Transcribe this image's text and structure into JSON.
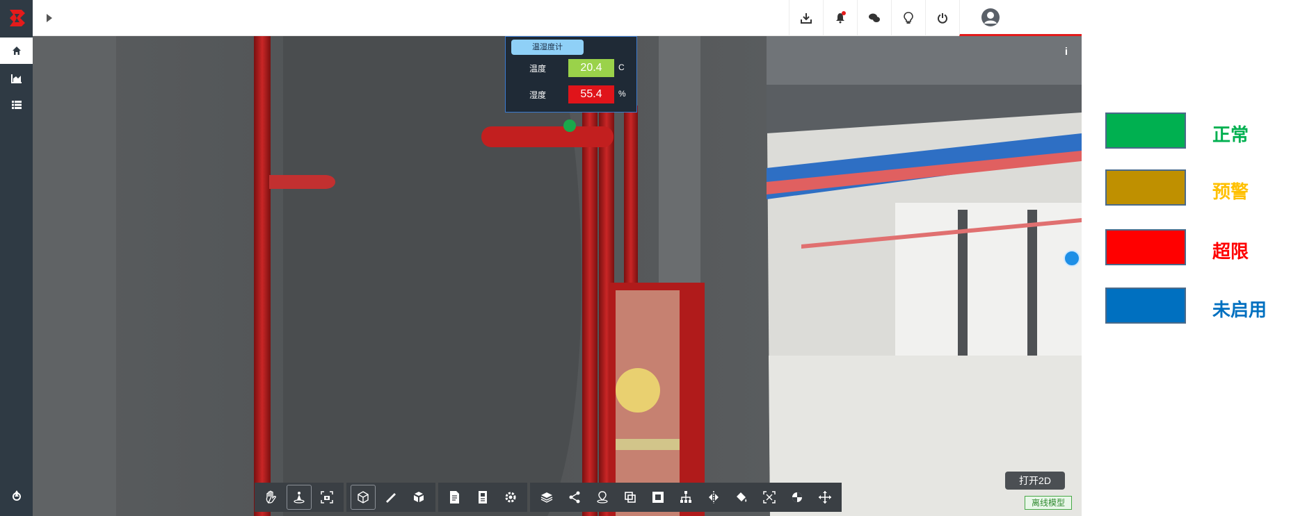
{
  "app": {
    "logo": "app-logo"
  },
  "sidebar": {
    "items": [
      {
        "icon": "home-icon",
        "active": true
      },
      {
        "icon": "chart-icon",
        "active": false
      },
      {
        "icon": "list-icon",
        "active": false
      }
    ],
    "bottom_icon": "recycle-icon"
  },
  "topbar": {
    "expand_icon": "caret-right-icon",
    "icons": [
      "download-icon",
      "bell-icon",
      "chat-icon",
      "lightbulb-icon",
      "power-icon",
      "user-icon"
    ]
  },
  "viewport": {
    "info_label": "i",
    "sensor": {
      "title": "温湿度计",
      "rows": [
        {
          "label": "温度",
          "value": "20.4",
          "unit": "C",
          "color": "#9ad24a"
        },
        {
          "label": "湿度",
          "value": "55.4",
          "unit": "%",
          "color": "#e0141a"
        }
      ],
      "status_color": "#1aa84b"
    },
    "open_2d_label": "打开2D",
    "offline_label": "离线模型"
  },
  "toolbar": {
    "groups": [
      [
        "hand-icon",
        "walk-icon",
        "camera-icon"
      ],
      [
        "cube-icon",
        "ruler-icon",
        "explode-icon"
      ],
      [
        "document-icon",
        "property-icon",
        "settings-icon"
      ],
      [
        "layers-icon",
        "share-icon",
        "location-icon",
        "copy-icon",
        "section-icon",
        "tree-icon",
        "split-icon",
        "paint-icon",
        "fit-icon",
        "pie-icon",
        "move-icon"
      ]
    ]
  },
  "legend": {
    "items": [
      {
        "label": "正常",
        "color": "#00b050",
        "text_color": "#00b050"
      },
      {
        "label": "预警",
        "color": "#bf9000",
        "text_color": "#ffc000"
      },
      {
        "label": "超限",
        "color": "#ff0000",
        "text_color": "#ff0000"
      },
      {
        "label": "未启用",
        "color": "#0070c0",
        "text_color": "#0070c0"
      }
    ]
  }
}
